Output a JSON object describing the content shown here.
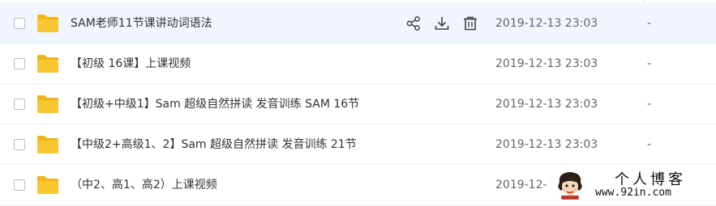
{
  "rows": [
    {
      "name": "SAM老师11节课讲动词语法",
      "date": "2019-12-13 23:03",
      "size": "-"
    },
    {
      "name": "【初级 16课】上课视频",
      "date": "2019-12-13 23:03",
      "size": "-"
    },
    {
      "name": "【初级+中级1】Sam 超级自然拼读 发音训练 SAM 16节",
      "date": "2019-12-13 23:03",
      "size": "-"
    },
    {
      "name": "【中级2+高级1、2】Sam 超级自然拼读 发音训练 21节",
      "date": "2019-12-13 23:03",
      "size": "-"
    },
    {
      "name": "（中2、高1、高2）上课视频",
      "date": "2019-12-1",
      "size": "-"
    }
  ],
  "hover_actions": {
    "share_icon": "share-icon",
    "download_icon": "download-icon",
    "delete_icon": "trash-icon"
  },
  "watermark": {
    "title": "个人博客",
    "url": "www.92in.com"
  },
  "colors": {
    "folder": "#f8c630",
    "folder_tab": "#f2b518",
    "hover_row": "#f1f6fe",
    "text": "#333333",
    "muted": "#666666"
  }
}
